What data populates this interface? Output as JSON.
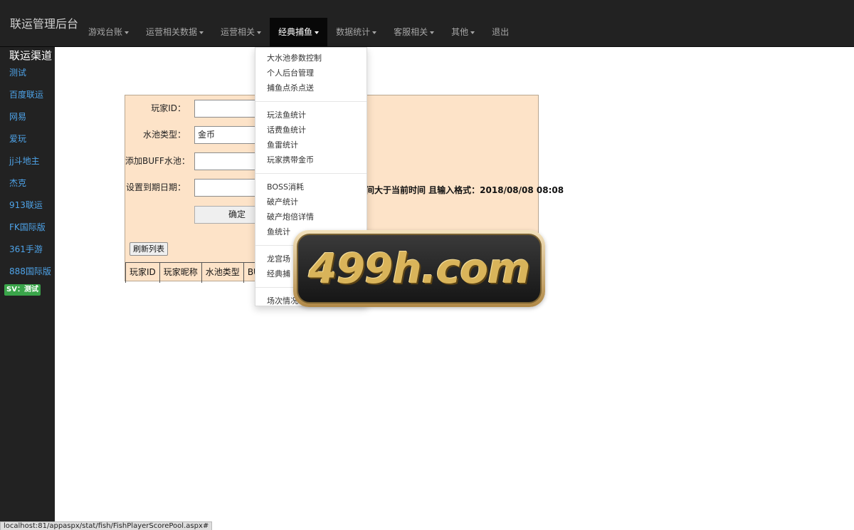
{
  "app": {
    "brand": "联运管理后台"
  },
  "nav": {
    "items": [
      {
        "label": "游戏台账",
        "caret": true,
        "active": false
      },
      {
        "label": "运营相关数据",
        "caret": true,
        "active": false
      },
      {
        "label": "运营相关",
        "caret": true,
        "active": false
      },
      {
        "label": "经典捕鱼",
        "caret": true,
        "active": true
      },
      {
        "label": "数据统计",
        "caret": true,
        "active": false
      },
      {
        "label": "客服相关",
        "caret": true,
        "active": false
      },
      {
        "label": "其他",
        "caret": true,
        "active": false
      },
      {
        "label": "退出",
        "caret": false,
        "active": false
      }
    ]
  },
  "sidebar": {
    "title": "联运渠道",
    "items": [
      "测试",
      "百度联运",
      "网易",
      "爱玩",
      "jj斗地主",
      "杰克",
      "913联运",
      "FK国际版",
      "361手游",
      "888国际版"
    ],
    "sv_badge": "SV：测试"
  },
  "form": {
    "player_id_label": "玩家ID：",
    "player_id_value": "",
    "pool_type_label": "水池类型：",
    "pool_type_value": "金币",
    "buff_pool_label": "添加BUFF水池：",
    "buff_pool_value": "",
    "expire_label": "设置到期日期：",
    "expire_value": "",
    "note": "间大于当前时间 且输入格式：2018/08/08 08:08",
    "confirm_label": "确定",
    "refresh_label": "刷新列表"
  },
  "table": {
    "headers": [
      "玩家ID",
      "玩家昵称",
      "水池类型",
      "BUF"
    ]
  },
  "dropdown": {
    "groups": [
      [
        "大水池参数控制",
        "个人后台管理",
        "捕鱼点杀点送"
      ],
      [
        "玩法鱼统计",
        "话费鱼统计",
        "鱼雷统计",
        "玩家携带金币"
      ],
      [
        "BOSS消耗",
        "破产统计",
        "破产炮倍详情",
        "鱼统计"
      ],
      [
        "龙宫场",
        "经典捕"
      ],
      [
        "场次情况"
      ]
    ]
  },
  "watermark": {
    "text": "499h.com"
  },
  "status": {
    "url": "localhost:81/appaspx/stat/fish/FishPlayerScorePool.aspx#"
  }
}
